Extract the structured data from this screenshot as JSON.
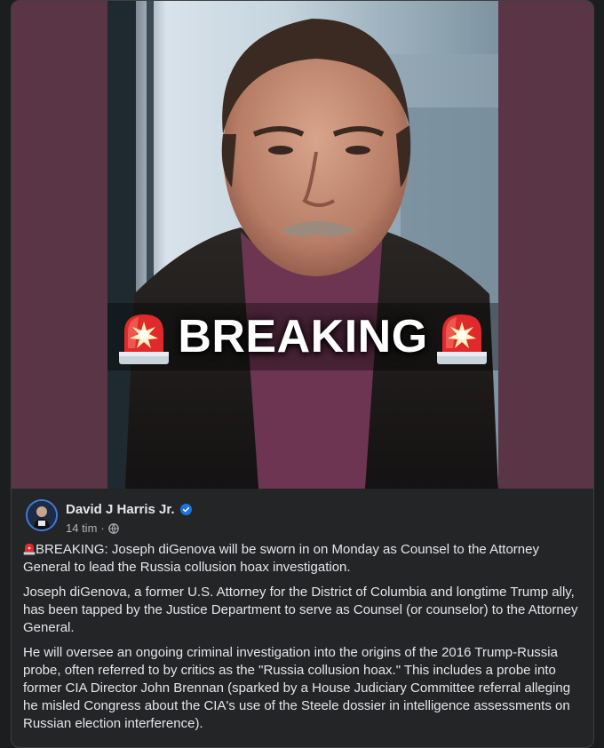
{
  "post": {
    "image": {
      "overlay_text": "BREAKING",
      "siren_icon": "police-siren-icon",
      "background_color": "#5a3546"
    },
    "author": {
      "name": "David J Harris Jr.",
      "verified": true,
      "avatar_icon": "avatar"
    },
    "meta": {
      "time": "14 tim",
      "separator": "·",
      "audience_icon": "globe-icon"
    },
    "paragraphs": [
      "BREAKING: Joseph diGenova will be sworn in on Monday as Counsel to the Attorney General to lead the Russia collusion hoax investigation.",
      "Joseph diGenova, a former U.S. Attorney for the District of Columbia and longtime Trump ally, has been tapped by the Justice Department to serve as Counsel (or counselor) to the Attorney General.",
      "He will oversee an ongoing criminal investigation into the origins of the 2016 Trump-Russia probe, often referred to by critics as the \"Russia collusion hoax.\" This includes a probe into former CIA Director John Brennan (sparked by a House Judiciary Committee referral alleging he misled Congress about the CIA's use of the Steele dossier in intelligence assessments on Russian election interference)."
    ]
  },
  "colors": {
    "card_bg": "#242526",
    "text_primary": "#e4e6eb",
    "text_secondary": "#b0b3b8",
    "verified_blue": "#1b74e4"
  }
}
